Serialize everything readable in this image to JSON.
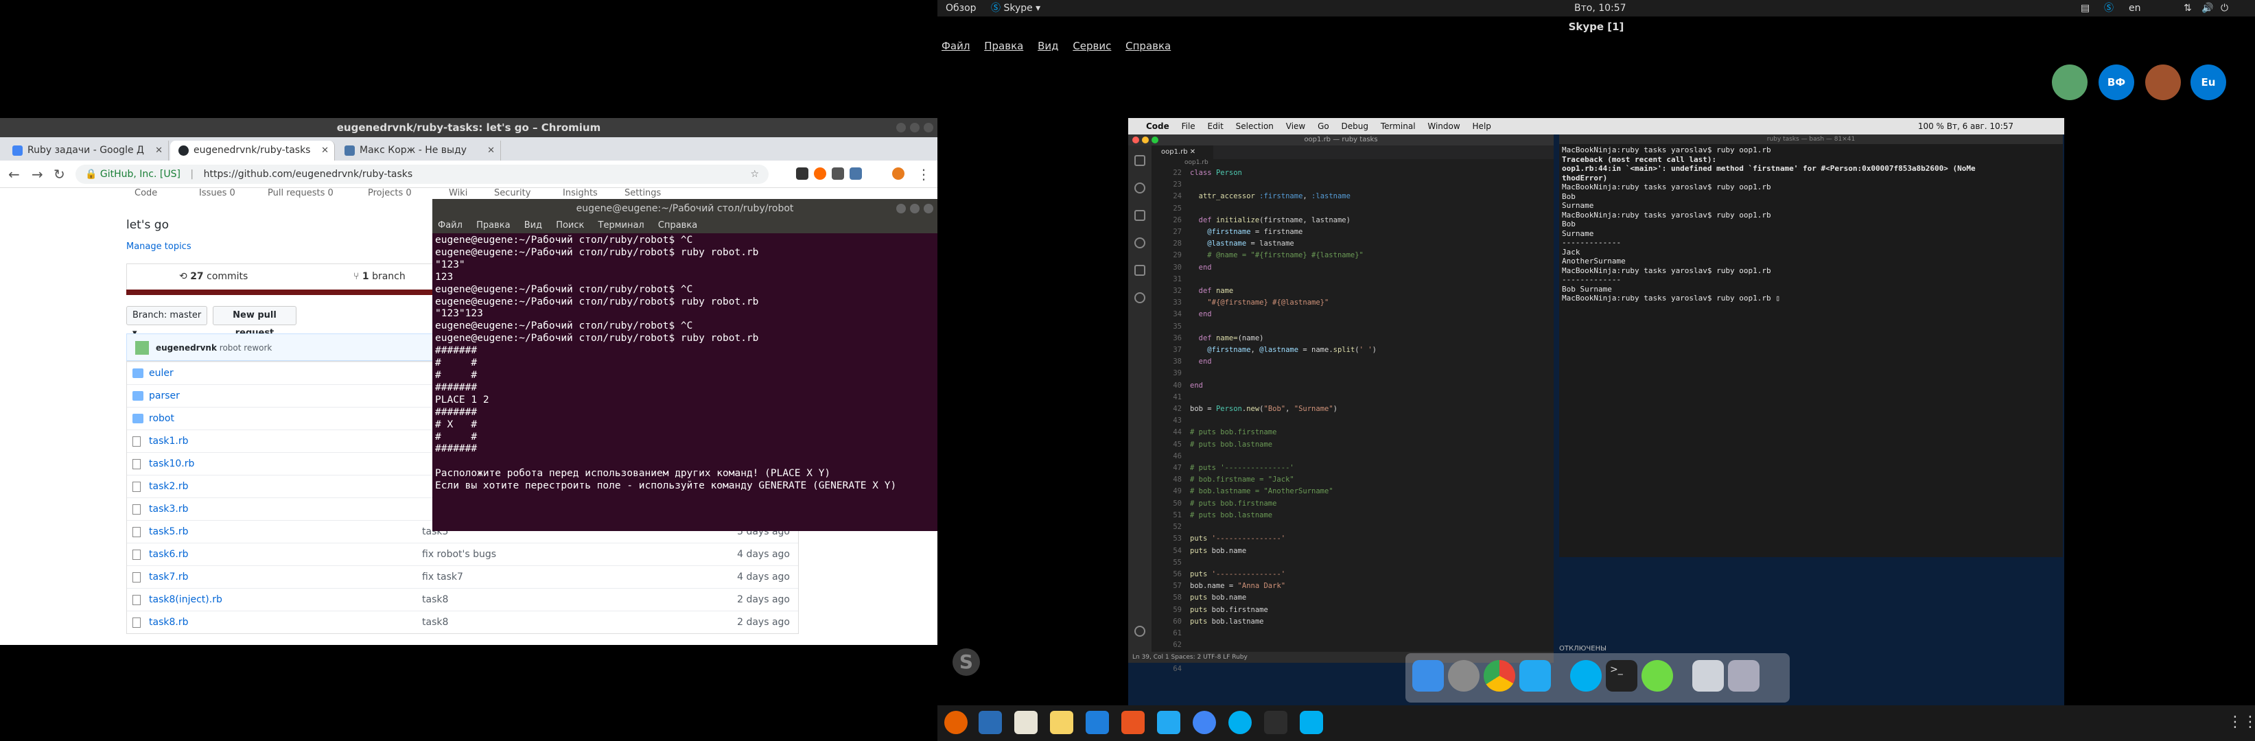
{
  "gnome_bar": {
    "overview": "Обзор",
    "app": "Skype",
    "clock": "Вто, 10:57",
    "lang": "en"
  },
  "skype": {
    "title": "Skype [1]",
    "menu": [
      "Файл",
      "Правка",
      "Вид",
      "Сервис",
      "Справка"
    ],
    "avatars": [
      {
        "label": "",
        "color": "#5aa36b"
      },
      {
        "label": "ВФ",
        "color": "#0078d4"
      },
      {
        "label": "",
        "color": "#a0522d"
      },
      {
        "label": "Eu",
        "color": "#0078d4"
      }
    ]
  },
  "chromium": {
    "window_title": "eugenedrvnk/ruby-tasks: let's go – Chromium",
    "tabs": [
      {
        "label": "Ruby задачи - Google Д",
        "icon_color": "#4285f4"
      },
      {
        "label": "eugenedrvnk/ruby-tasks",
        "icon_color": "#24292e"
      },
      {
        "label": "Макс Корж - Не выду",
        "icon_color": "#4a76a8"
      }
    ],
    "new_tab": "+",
    "cert": "GitHub, Inc. [US]",
    "url": "https://github.com/eugenedrvnk/ruby-tasks",
    "repo_nav": [
      "Code",
      "Issues 0",
      "Pull requests 0",
      "Projects 0",
      "Wiki",
      "Security",
      "Insights",
      "Settings"
    ],
    "description": "let's go",
    "manage_topics": "Manage topics",
    "commits_count": "27",
    "commits_label": "commits",
    "branch_count": "1",
    "branch_label": "branch",
    "branch_button": "Branch: master ▾",
    "new_pr": "New pull request",
    "last_commit_user": "eugenedrvnk",
    "last_commit_msg": "robot rework",
    "files": [
      {
        "name": "euler",
        "type": "dir",
        "commit": "",
        "age": ""
      },
      {
        "name": "parser",
        "type": "dir",
        "commit": "",
        "age": ""
      },
      {
        "name": "robot",
        "type": "dir",
        "commit": "",
        "age": ""
      },
      {
        "name": "task1.rb",
        "type": "file",
        "commit": "",
        "age": ""
      },
      {
        "name": "task10.rb",
        "type": "file",
        "commit": "",
        "age": ""
      },
      {
        "name": "task2.rb",
        "type": "file",
        "commit": "",
        "age": ""
      },
      {
        "name": "task3.rb",
        "type": "file",
        "commit": "",
        "age": ""
      },
      {
        "name": "task5.rb",
        "type": "file",
        "commit": "task5",
        "age": "5 days ago"
      },
      {
        "name": "task6.rb",
        "type": "file",
        "commit": "fix robot's bugs",
        "age": "4 days ago"
      },
      {
        "name": "task7.rb",
        "type": "file",
        "commit": "fix task7",
        "age": "4 days ago"
      },
      {
        "name": "task8(inject).rb",
        "type": "file",
        "commit": "task8",
        "age": "2 days ago"
      },
      {
        "name": "task8.rb",
        "type": "file",
        "commit": "task8",
        "age": "2 days ago"
      }
    ]
  },
  "terminal": {
    "title": "eugene@eugene:~/Рабочий стол/ruby/robot",
    "menu": [
      "Файл",
      "Правка",
      "Вид",
      "Поиск",
      "Терминал",
      "Справка"
    ],
    "lines": [
      "eugene@eugene:~/Рабочий стол/ruby/robot$ ^C",
      "eugene@eugene:~/Рабочий стол/ruby/robot$ ruby robot.rb",
      "\"123\"",
      "123",
      "eugene@eugene:~/Рабочий стол/ruby/robot$ ^C",
      "eugene@eugene:~/Рабочий стол/ruby/robot$ ruby robot.rb",
      "\"123\"123",
      "eugene@eugene:~/Рабочий стол/ruby/robot$ ^C",
      "eugene@eugene:~/Рабочий стол/ruby/robot$ ruby robot.rb",
      "#######",
      "#     #",
      "#     #",
      "#######",
      "PLACE 1 2",
      "#######",
      "# X   #",
      "#     #",
      "#######",
      "",
      "Расположите робота перед использованием других команд! (PLACE X Y)",
      "Если вы хотите перестроить поле - используйте команду GENERATE (GENERATE X Y)"
    ]
  },
  "mac": {
    "menubar": [
      "Code",
      "File",
      "Edit",
      "Selection",
      "View",
      "Go",
      "Debug",
      "Terminal",
      "Window",
      "Help"
    ],
    "menubar_right": "100 %   Вт, 6 авг.  10:57",
    "vscode": {
      "title": "oop1.rb — ruby tasks",
      "tab": "oop1.rb",
      "breadcrumb": "oop1.rb",
      "status": "Ln 39, Col 1   Spaces: 2   UTF-8   LF   Ruby",
      "line_numbers": "22\n23\n24\n25\n26\n27\n28\n29\n30\n31\n32\n33\n34\n35\n36\n37\n38\n39\n40\n41\n42\n43\n44\n45\n46\n47\n48\n49\n50\n51\n52\n53\n54\n55\n56\n57\n58\n59\n60\n61\n62\n63\n64"
    },
    "rterm_title": "ruby tasks — bash — 81×41",
    "rterm_lines": [
      "MacBookNinja:ruby tasks yaroslav$ ruby oop1.rb",
      "Traceback (most recent call last):",
      "oop1.rb:44:in `<main>': undefined method `firstname' for #<Person:0x00007f853a8b2600> (NoMe",
      "thodError)",
      "MacBookNinja:ruby tasks yaroslav$ ruby oop1.rb",
      "Bob",
      "Surname",
      "MacBookNinja:ruby tasks yaroslav$ ruby oop1.rb",
      "Bob",
      "Surname",
      "-------------",
      "Jack",
      "AnotherSurname",
      "MacBookNinja:ruby tasks yaroslav$ ruby oop1.rb",
      "-------------",
      "Bob Surname",
      "MacBookNinja:ruby tasks yaroslav$ ruby oop1.rb ▯"
    ],
    "sharing_status": "ОТКЛЮЧЕНЫ"
  },
  "colors": {
    "terminal_bg": "#300a24",
    "vscode_bg": "#1e1e1e",
    "github_link": "#0366d6"
  }
}
